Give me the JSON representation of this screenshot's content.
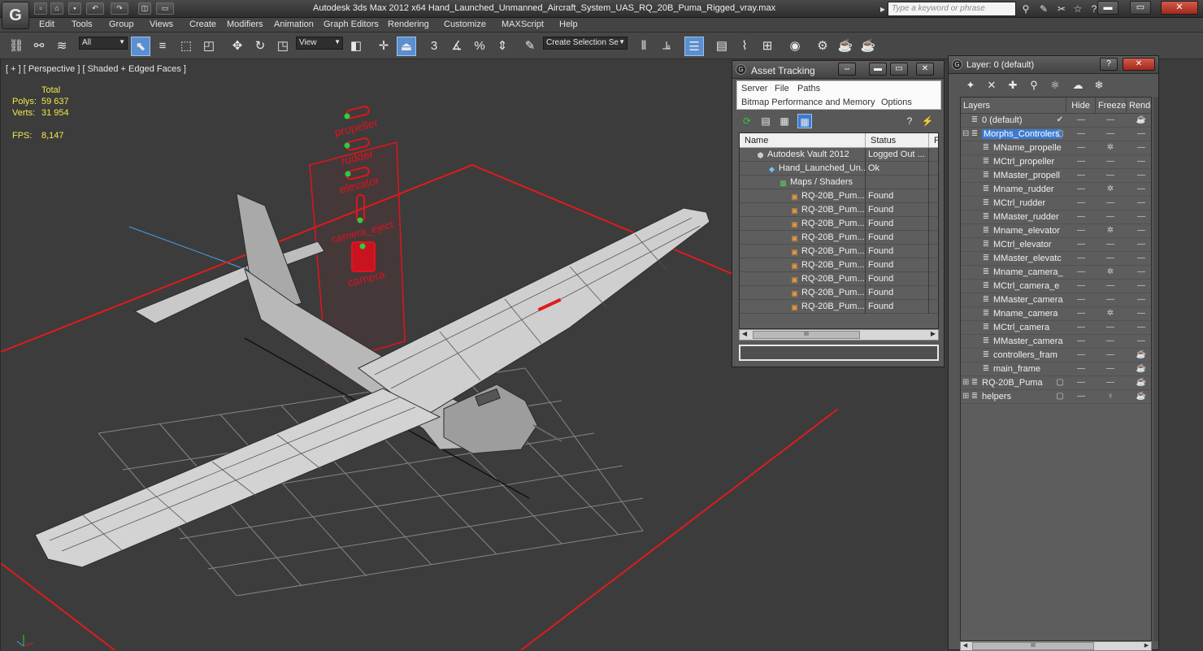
{
  "app": {
    "logo": "G",
    "title": "Autodesk 3ds Max 2012 x64     Hand_Launched_Unmanned_Aircraft_System_UAS_RQ_20B_Puma_Rigged_vray.max",
    "search_placeholder": "Type a keyword or phrase"
  },
  "menu": [
    "Edit",
    "Tools",
    "Group",
    "Views",
    "Create",
    "Modifiers",
    "Animation",
    "Graph Editors",
    "Rendering",
    "Customize",
    "MAXScript",
    "Help"
  ],
  "toolbar": {
    "selection_filter": "All",
    "ref_coord": "View",
    "snap_label": "3",
    "named_selection_placeholder": "Create Selection Se"
  },
  "viewport": {
    "label": "[ + ] [ Perspective ] [ Shaded + Edged Faces ]",
    "stats": {
      "total_label": "Total",
      "polys_label": "Polys:",
      "polys_value": "59 637",
      "verts_label": "Verts:",
      "verts_value": "31 954",
      "fps_label": "FPS:",
      "fps_value": "8,147"
    },
    "controllers": [
      "propeller",
      "rudder",
      "elevator",
      "camera_eject",
      "camera"
    ]
  },
  "asset_tracking": {
    "title": "Asset Tracking",
    "menus_row1": [
      "Server",
      "File",
      "Paths"
    ],
    "menus_row2": [
      "Bitmap Performance and Memory",
      "Options"
    ],
    "columns": [
      "Name",
      "Status",
      "P"
    ],
    "rows": [
      {
        "name": "Autodesk Vault 2012",
        "status": "Logged Out ...",
        "indent": 0,
        "icon": "vault"
      },
      {
        "name": "Hand_Launched_Un...",
        "status": "Ok",
        "indent": 1,
        "icon": "max-file"
      },
      {
        "name": "Maps / Shaders",
        "status": "",
        "indent": 2,
        "icon": "maps"
      },
      {
        "name": "RQ-20B_Pum...",
        "status": "Found",
        "indent": 3,
        "icon": "bitmap"
      },
      {
        "name": "RQ-20B_Pum...",
        "status": "Found",
        "indent": 3,
        "icon": "bitmap"
      },
      {
        "name": "RQ-20B_Pum...",
        "status": "Found",
        "indent": 3,
        "icon": "bitmap"
      },
      {
        "name": "RQ-20B_Pum...",
        "status": "Found",
        "indent": 3,
        "icon": "bitmap"
      },
      {
        "name": "RQ-20B_Pum...",
        "status": "Found",
        "indent": 3,
        "icon": "bitmap"
      },
      {
        "name": "RQ-20B_Pum...",
        "status": "Found",
        "indent": 3,
        "icon": "bitmap"
      },
      {
        "name": "RQ-20B_Pum...",
        "status": "Found",
        "indent": 3,
        "icon": "bitmap"
      },
      {
        "name": "RQ-20B_Pum...",
        "status": "Found",
        "indent": 3,
        "icon": "bitmap"
      },
      {
        "name": "RQ-20B_Pum...",
        "status": "Found",
        "indent": 3,
        "icon": "bitmap"
      }
    ],
    "scroll_grip": "III"
  },
  "layer_panel": {
    "title": "Layer: 0 (default)",
    "columns": [
      "Layers",
      "Hide",
      "Freeze",
      "Rende"
    ],
    "rows": [
      {
        "name": "0 (default)",
        "indent": 0,
        "check": true,
        "freeze": "—",
        "render": "teapot"
      },
      {
        "name": "Morphs_Controlers",
        "indent": 0,
        "selected": true,
        "box": true,
        "freeze": "—",
        "render": "—"
      },
      {
        "name": "MName_propelle",
        "indent": 1,
        "freeze": "snow",
        "render": "—"
      },
      {
        "name": "MCtrl_propeller",
        "indent": 1,
        "freeze": "—",
        "render": "—"
      },
      {
        "name": "MMaster_propell",
        "indent": 1,
        "freeze": "—",
        "render": "—"
      },
      {
        "name": "Mname_rudder",
        "indent": 1,
        "freeze": "snow",
        "render": "—"
      },
      {
        "name": "MCtrl_rudder",
        "indent": 1,
        "freeze": "—",
        "render": "—"
      },
      {
        "name": "MMaster_rudder",
        "indent": 1,
        "freeze": "—",
        "render": "—"
      },
      {
        "name": "Mname_elevator",
        "indent": 1,
        "freeze": "snow",
        "render": "—"
      },
      {
        "name": "MCtrl_elevator",
        "indent": 1,
        "freeze": "—",
        "render": "—"
      },
      {
        "name": "MMaster_elevatc",
        "indent": 1,
        "freeze": "—",
        "render": "—"
      },
      {
        "name": "Mname_camera_",
        "indent": 1,
        "freeze": "snow",
        "render": "—"
      },
      {
        "name": "MCtrl_camera_e",
        "indent": 1,
        "freeze": "—",
        "render": "—"
      },
      {
        "name": "MMaster_camera",
        "indent": 1,
        "freeze": "—",
        "render": "—"
      },
      {
        "name": "Mname_camera",
        "indent": 1,
        "freeze": "snow",
        "render": "—"
      },
      {
        "name": "MCtrl_camera",
        "indent": 1,
        "freeze": "—",
        "render": "—"
      },
      {
        "name": "MMaster_camera",
        "indent": 1,
        "freeze": "—",
        "render": "—"
      },
      {
        "name": "controllers_fram",
        "indent": 1,
        "freeze": "—",
        "render": "teapot"
      },
      {
        "name": "main_frame",
        "indent": 1,
        "freeze": "—",
        "render": "teapot"
      },
      {
        "name": "RQ-20B_Puma",
        "indent": 0,
        "box": true,
        "freeze": "—",
        "render": "teapot"
      },
      {
        "name": "helpers",
        "indent": 0,
        "box": true,
        "freeze": "bulb",
        "render": "teapot"
      }
    ],
    "scroll_grip": "III"
  },
  "colors": {
    "accent_select": "#3d7bd1",
    "controller_red": "#e0141e",
    "stat_yellow": "#f2e84a",
    "grid_red": "#e01b1b"
  }
}
